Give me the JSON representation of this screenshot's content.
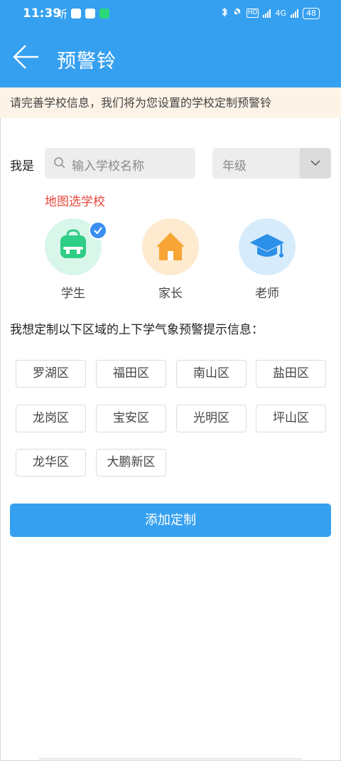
{
  "status_bar": {
    "time": "11:39",
    "ting": "听",
    "right_net": "4G",
    "battery": "48"
  },
  "header": {
    "title": "预警铃"
  },
  "notice": {
    "text": "请完善学校信息，我们将为您设置的学校定制预警铃"
  },
  "form": {
    "label": "我是",
    "search_placeholder": "输入学校名称",
    "grade_placeholder": "年级",
    "map_pick": "地图选学校"
  },
  "roles": [
    {
      "label": "学生",
      "selected": true,
      "color": "#d9f6ea"
    },
    {
      "label": "家长",
      "selected": false,
      "color": "#fdeacf"
    },
    {
      "label": "老师",
      "selected": false,
      "color": "#d6ecfb"
    }
  ],
  "areas": {
    "title": "我想定制以下区域的上下学气象预警提示信息：",
    "items": [
      "罗湖区",
      "福田区",
      "南山区",
      "盐田区",
      "龙岗区",
      "宝安区",
      "光明区",
      "坪山区",
      "龙华区",
      "大鹏新区"
    ]
  },
  "submit": {
    "label": "添加定制"
  },
  "colors": {
    "primary": "#36a0f0",
    "accent_red": "#e8463c",
    "notice_bg": "#fdf3e7"
  }
}
